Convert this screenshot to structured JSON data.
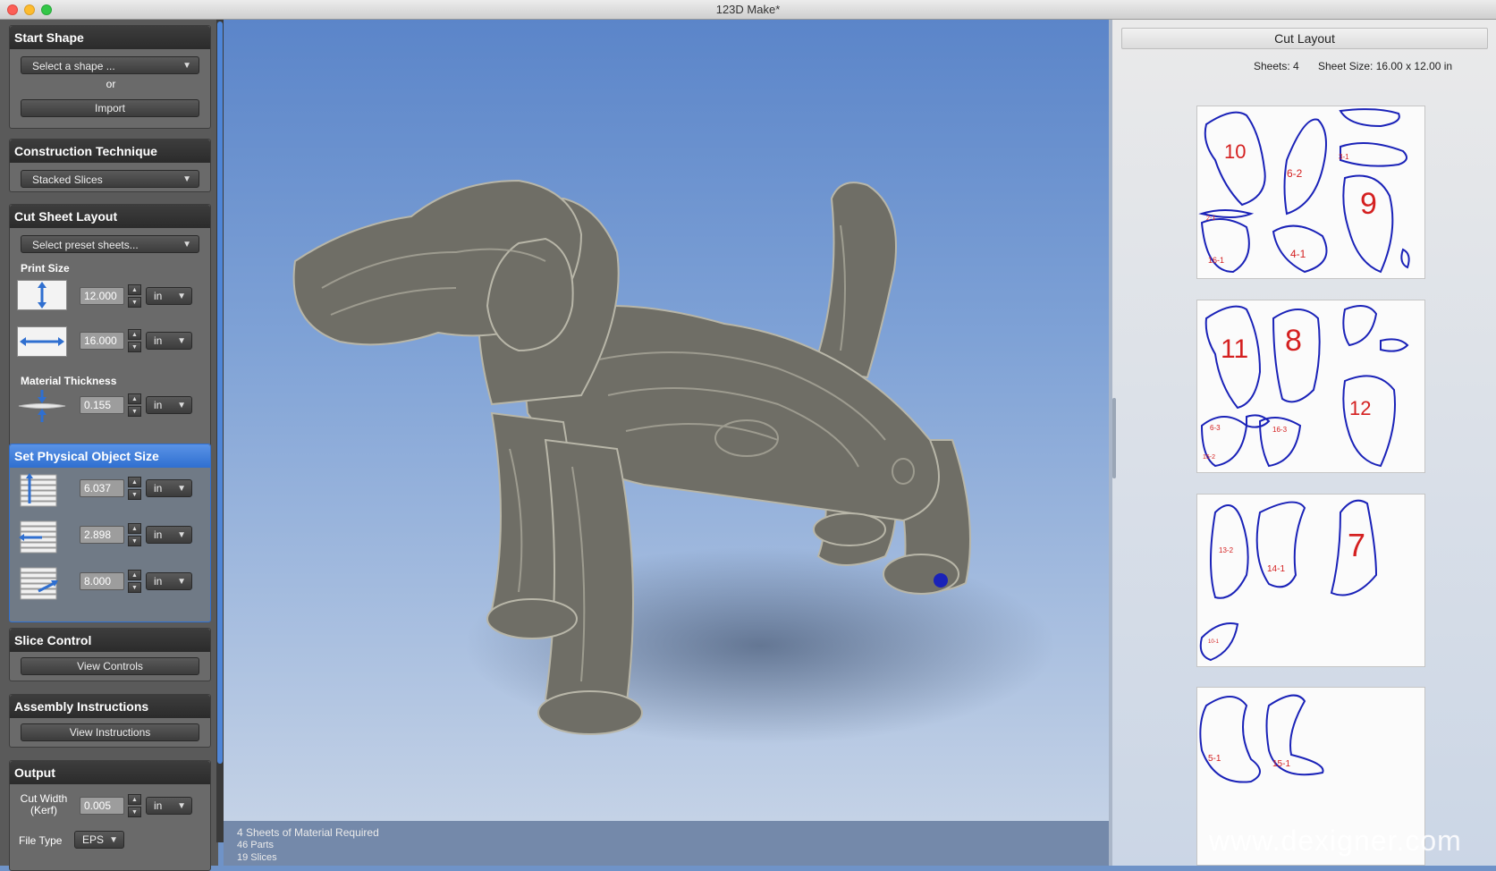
{
  "window": {
    "title": "123D Make*"
  },
  "sidebar": {
    "start_shape": {
      "header": "Start Shape",
      "select_label": "Select a shape ...",
      "or_label": "or",
      "import_label": "Import"
    },
    "construction": {
      "header": "Construction Technique",
      "value": "Stacked Slices"
    },
    "cut_sheet": {
      "header": "Cut Sheet Layout",
      "preset_label": "Select preset sheets...",
      "print_size_label": "Print Size",
      "height": "12.000",
      "height_unit": "in",
      "width": "16.000",
      "width_unit": "in",
      "thickness_label": "Material Thickness",
      "thickness": "0.155",
      "thickness_unit": "in"
    },
    "object_size": {
      "header": "Set Physical Object Size",
      "height": "6.037",
      "height_unit": "in",
      "width": "2.898",
      "width_unit": "in",
      "depth": "8.000",
      "depth_unit": "in"
    },
    "slice_control": {
      "header": "Slice Control",
      "button": "View Controls"
    },
    "assembly": {
      "header": "Assembly Instructions",
      "button": "View Instructions"
    },
    "output": {
      "header": "Output",
      "cut_width_label": "Cut Width",
      "kerf_label": "(Kerf)",
      "cut_width": "0.005",
      "cut_width_unit": "in",
      "file_type_label": "File Type",
      "file_type": "EPS"
    }
  },
  "viewport": {
    "status": {
      "sheets": "4 Sheets of Material Required",
      "parts": "46 Parts",
      "slices": "19 Slices"
    }
  },
  "cut_layout": {
    "header": "Cut Layout",
    "sheets_label": "Sheets: 4",
    "sheet_size_label": "Sheet Size: 16.00 x 12.00 in",
    "sheets": [
      {
        "big": [
          "10",
          "6-2",
          "9",
          "4-1"
        ],
        "small": [
          "3-1",
          "16-1",
          "2-1"
        ]
      },
      {
        "big": [
          "11",
          "8",
          "12"
        ],
        "small": [
          "6-3",
          "16-3",
          "15-2"
        ]
      },
      {
        "big": [
          "7"
        ],
        "small": [
          "13-2",
          "14-1",
          "10-1"
        ]
      },
      {
        "big": [],
        "small": [
          "5-1",
          "15-1"
        ]
      }
    ]
  },
  "watermark": "www.dexigner.com",
  "colors": {
    "accent": "#2f6fd0",
    "outline": "#1a22b8",
    "label_red": "#d42020",
    "highlight": "#f0e020"
  }
}
